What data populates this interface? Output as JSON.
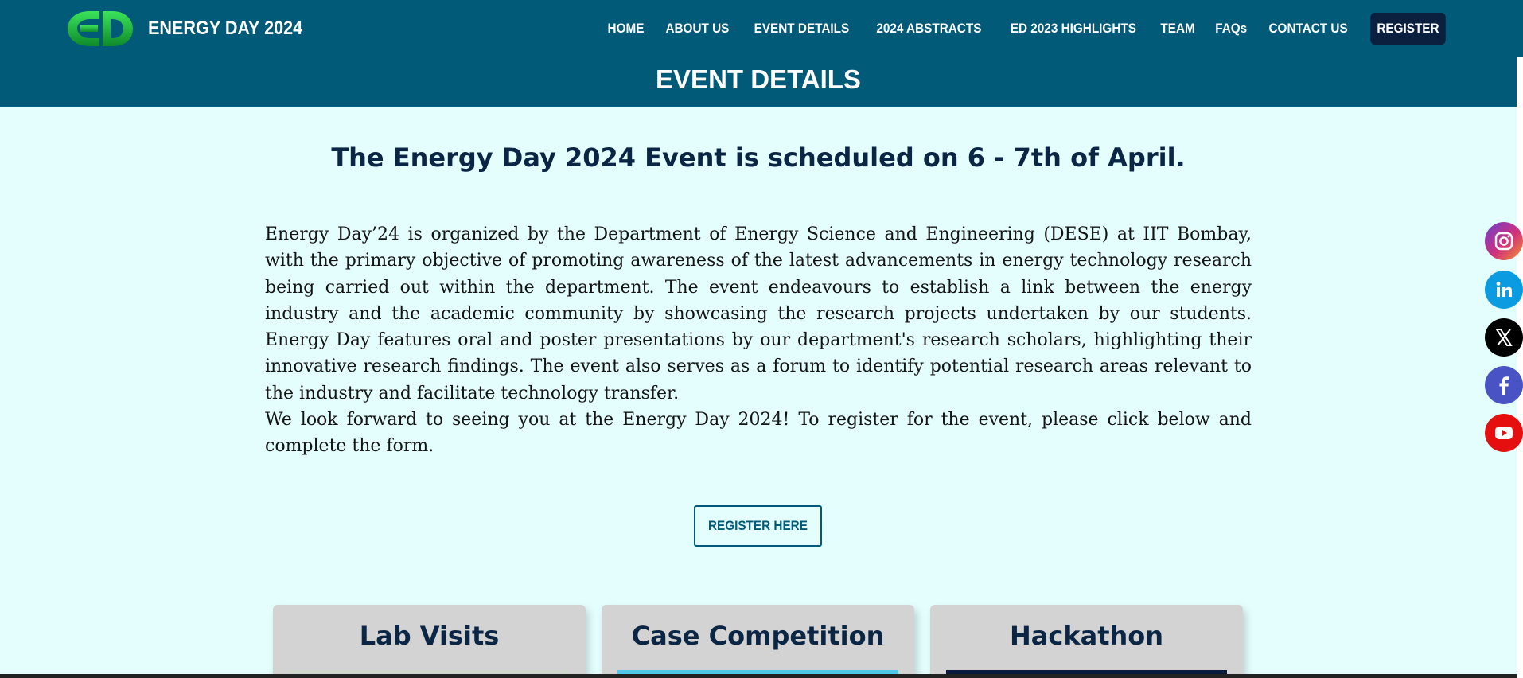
{
  "header": {
    "brand": "ENERGY DAY 2024",
    "logo": "ED",
    "nav": [
      {
        "label": "HOME",
        "name": "nav-home"
      },
      {
        "label": "ABOUT US",
        "name": "nav-about-us"
      },
      {
        "label": "EVENT DETAILS",
        "name": "nav-event-details"
      },
      {
        "label": "2024 ABSTRACTS",
        "name": "nav-2024-abstracts"
      },
      {
        "label": "ED 2023 HIGHLIGHTS",
        "name": "nav-ed-2023-highlights"
      },
      {
        "label": "TEAM",
        "name": "nav-team"
      },
      {
        "label": "FAQs",
        "name": "nav-faqs"
      },
      {
        "label": "CONTACT US",
        "name": "nav-contact-us"
      }
    ],
    "register_label": "REGISTER",
    "page_heading": "EVENT DETAILS"
  },
  "main": {
    "headline": "The Energy Day 2024 Event is scheduled on 6 - 7th of April.",
    "paragraph1": "Energy Day’24 is organized by the Department of Energy Science and Engineering (DESE) at IIT Bombay, with the primary objective of promoting awareness of the latest advancements in energy technology research being carried out within the department. The event endeavours to establish a link between the energy industry and the academic community by showcasing the research projects undertaken by our students. Energy Day features oral and poster presentations by our department's research scholars, highlighting their innovative research findings. The event also serves as a forum to identify potential research areas relevant to the industry and facilitate technology transfer.",
    "paragraph2": "We look forward to seeing you at the Energy Day 2024! To register for the event, please click below and complete the form.",
    "register_button": "REGISTER HERE"
  },
  "cards": [
    {
      "title": "Lab Visits"
    },
    {
      "title": "Case Competition"
    },
    {
      "title": "Hackathon"
    }
  ],
  "social": [
    "instagram-icon",
    "linkedin-icon",
    "x-icon",
    "facebook-icon",
    "youtube-icon"
  ],
  "colors": {
    "header_bg": "#015a78",
    "page_bg": "#e4fefe",
    "headline": "#0b2545",
    "register_nav_bg": "#0b1f3f",
    "card_bg": "#d3d3d3"
  }
}
